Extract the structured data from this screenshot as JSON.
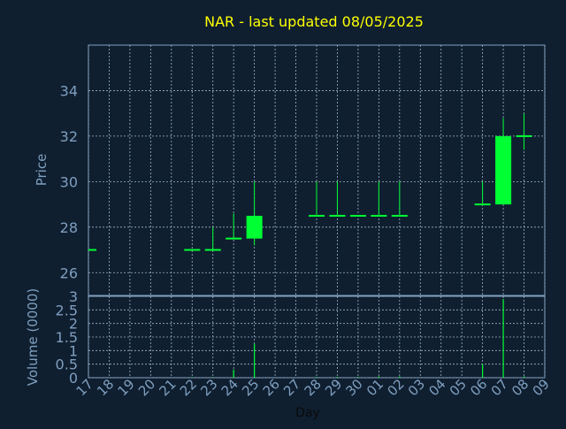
{
  "chart_data": [
    {
      "type": "candlestick",
      "title": "NAR - last updated 08/05/2025",
      "ylabel": "Price",
      "ylim": [
        25,
        36
      ],
      "yticks": [
        26,
        28,
        30,
        32,
        34
      ],
      "grid": true,
      "x_ticks": [
        "17",
        "18",
        "19",
        "20",
        "21",
        "22",
        "23",
        "24",
        "25",
        "26",
        "27",
        "28",
        "29",
        "30",
        "01",
        "02",
        "03",
        "04",
        "05",
        "06",
        "07",
        "08",
        "09"
      ],
      "candles": [
        {
          "day": "17",
          "open": 27.0,
          "high": 27.0,
          "low": 27.0,
          "close": 27.0
        },
        {
          "day": "22",
          "open": 27.0,
          "high": 27.0,
          "low": 27.0,
          "close": 27.0
        },
        {
          "day": "23",
          "open": 27.0,
          "high": 28.0,
          "low": 27.0,
          "close": 27.0
        },
        {
          "day": "24",
          "open": 27.5,
          "high": 28.6,
          "low": 27.5,
          "close": 27.5
        },
        {
          "day": "25",
          "open": 27.5,
          "high": 30.0,
          "low": 27.2,
          "close": 28.5
        },
        {
          "day": "28",
          "open": 28.5,
          "high": 30.0,
          "low": 28.5,
          "close": 28.5
        },
        {
          "day": "29",
          "open": 28.5,
          "high": 30.0,
          "low": 28.5,
          "close": 28.5
        },
        {
          "day": "30",
          "open": 28.5,
          "high": 28.5,
          "low": 28.5,
          "close": 28.5
        },
        {
          "day": "01",
          "open": 28.5,
          "high": 30.0,
          "low": 28.5,
          "close": 28.5
        },
        {
          "day": "02",
          "open": 28.5,
          "high": 30.0,
          "low": 28.5,
          "close": 28.5
        },
        {
          "day": "06",
          "open": 29.0,
          "high": 30.0,
          "low": 29.0,
          "close": 29.0
        },
        {
          "day": "07",
          "open": 29.0,
          "high": 32.8,
          "low": 29.0,
          "close": 32.0
        },
        {
          "day": "08",
          "open": 32.0,
          "high": 33.0,
          "low": 31.4,
          "close": 32.0
        }
      ]
    },
    {
      "type": "bar",
      "ylabel": "Volume (0000)",
      "xlabel": "Day",
      "ylim": [
        0,
        3
      ],
      "yticks": [
        "0",
        "0.5",
        "1",
        "1.5",
        "2",
        "2.5",
        "3"
      ],
      "grid": true,
      "categories": [
        "17",
        "18",
        "19",
        "20",
        "21",
        "22",
        "23",
        "24",
        "25",
        "26",
        "27",
        "28",
        "29",
        "30",
        "01",
        "02",
        "03",
        "04",
        "05",
        "06",
        "07",
        "08",
        "09"
      ],
      "values": [
        0,
        0,
        0,
        0,
        0,
        0.02,
        0.02,
        0.3,
        1.25,
        0,
        0,
        0.03,
        0.03,
        0.03,
        0.05,
        0.05,
        0,
        0,
        0,
        0.5,
        2.9,
        0.05,
        0
      ]
    }
  ],
  "colors": {
    "background": "#0f1f30",
    "axis": "#7f9fbf",
    "grid": "#a0b4c8",
    "title": "#ffff00",
    "candle": "#00ff33"
  }
}
